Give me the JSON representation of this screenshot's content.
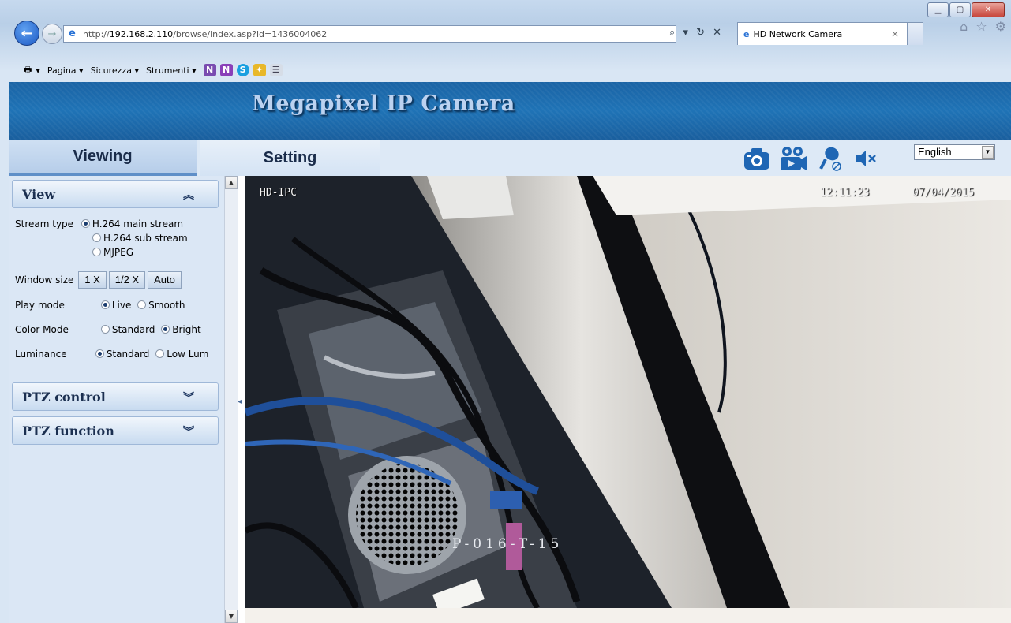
{
  "browser": {
    "url_prefix": "http://",
    "url_host": "192.168.2.110",
    "url_path": "/browse/index.asp?id=1436004062",
    "url_actions": "⌕ ▾ ↻ ✕",
    "tab_title": "HD Network Camera",
    "tab_close": "×",
    "command_bar": {
      "print_menu": "▾",
      "page_menu": "Pagina ▾",
      "security_menu": "Sicurezza ▾",
      "tools_menu": "Strumenti ▾"
    }
  },
  "banner": {
    "title": "Megapixel IP Camera"
  },
  "tabs": {
    "viewing": "Viewing",
    "setting": "Setting"
  },
  "toolbar": {
    "icons": [
      "snapshot-icon",
      "record-icon",
      "microphone-icon",
      "mute-icon"
    ],
    "language": "English"
  },
  "sidebar": {
    "view": {
      "title": "View",
      "stream_type_label": "Stream type",
      "stream_options": [
        "H.264 main stream",
        "H.264 sub stream",
        "MJPEG"
      ],
      "window_size_label": "Window size",
      "window_sizes": [
        "1 X",
        "1/2 X",
        "Auto"
      ],
      "play_mode_label": "Play mode",
      "play_modes": [
        "Live",
        "Smooth"
      ],
      "color_mode_label": "Color Mode",
      "color_modes": [
        "Standard",
        "Bright"
      ],
      "luminance_label": "Luminance",
      "luminance_modes": [
        "Standard",
        "Low Lum"
      ]
    },
    "ptz_control": {
      "title": "PTZ control"
    },
    "ptz_function": {
      "title": "PTZ function"
    }
  },
  "video": {
    "osd_name": "HD-IPC",
    "osd_time": "12:11:23",
    "osd_date": "07/04/2015"
  }
}
